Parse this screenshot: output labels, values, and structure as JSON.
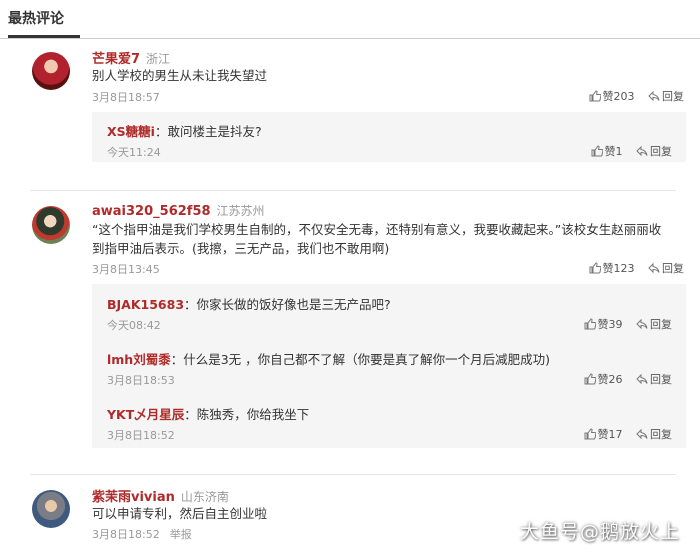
{
  "tab": {
    "title": "最热评论"
  },
  "labels": {
    "like": "赞",
    "reply": "回复",
    "report": "举报"
  },
  "comments": [
    {
      "user": "芒果爱7",
      "location": "浙江",
      "text": "别人学校的男生从未让我失望过",
      "time": "3月8日18:57",
      "likes": "203",
      "replies": [
        {
          "user": "XS糖糖i",
          "text": "敢问楼主是抖友?",
          "time": "今天11:24",
          "likes": "1"
        }
      ]
    },
    {
      "user": "awai320_562f58",
      "location": "江苏苏州",
      "text_line1": "“这个指甲油是我们学校男生自制的，不仅安全无毒，还特别有意义，我要收藏起来。”该校女生赵丽丽收",
      "text_line2": "到指甲油后表示。(我擦，三无产品，我们也不敢用啊)",
      "time": "3月8日13:45",
      "likes": "123",
      "replies": [
        {
          "user": "BJAK15683",
          "text": "你家长做的饭好像也是三无产品吧?",
          "time": "今天08:42",
          "likes": "39"
        },
        {
          "user": "lmh刘蜀黍",
          "text": "什么是3无 ，你自己都不了解（你要是真了解你一个月后减肥成功)",
          "time": "3月8日18:53",
          "likes": "26"
        },
        {
          "user": "YKT乄月星辰",
          "text": "陈独秀，你给我坐下",
          "time": "3月8日18:52",
          "likes": "17"
        }
      ]
    },
    {
      "user": "紫茉雨vivian",
      "location": "山东济南",
      "text": "可以申请专利，然后自主创业啦",
      "time": "3月8日18:52"
    }
  ],
  "watermark": "大鱼号@鹅放火上"
}
